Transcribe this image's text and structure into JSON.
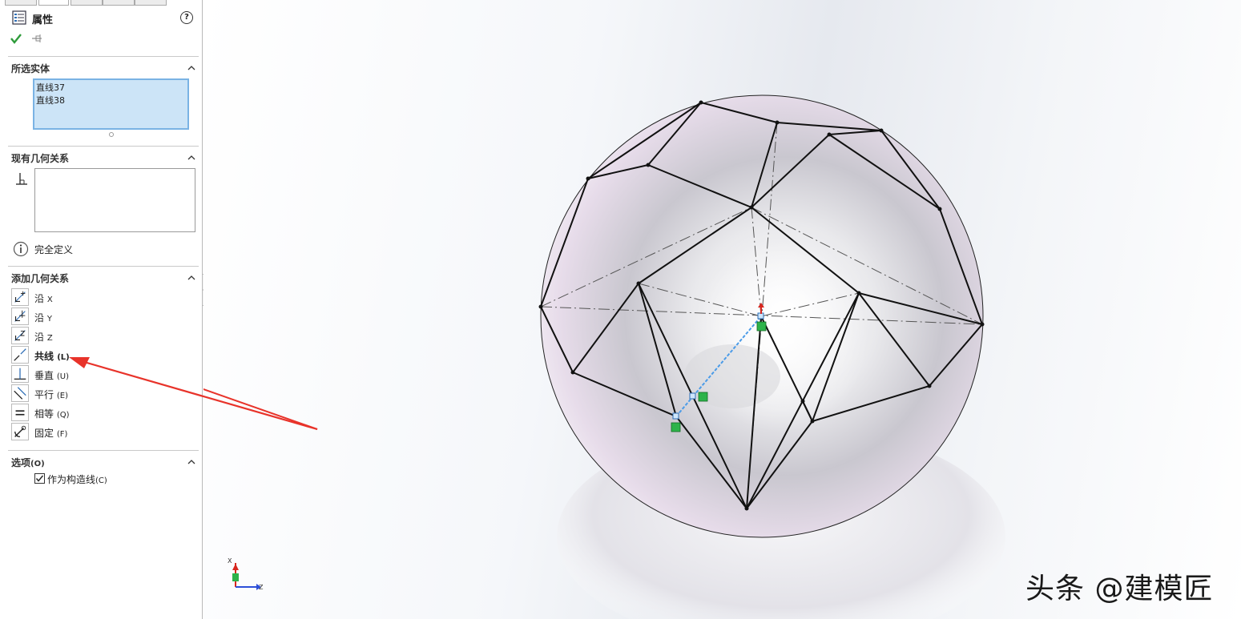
{
  "panel": {
    "title": "属性",
    "help_icon": "?",
    "sections": {
      "selected": {
        "title": "所选实体",
        "items": [
          "直线37",
          "直线38"
        ]
      },
      "existing": {
        "title": "现有几何关系",
        "status": "完全定义"
      },
      "add": {
        "title": "添加几何关系",
        "items": [
          {
            "main": "沿",
            "suffix": "X"
          },
          {
            "main": "沿",
            "suffix": "Y"
          },
          {
            "main": "沿",
            "suffix": "Z"
          },
          {
            "main": "共线",
            "suffix": "(L)"
          },
          {
            "main": "垂直",
            "suffix": "(U)"
          },
          {
            "main": "平行",
            "suffix": "(E)"
          },
          {
            "main": "相等",
            "suffix": "(Q)"
          },
          {
            "main": "固定",
            "suffix": "(F)"
          }
        ]
      },
      "options": {
        "title": "选项",
        "title_suffix": "(O)",
        "checkbox_label": "作为构造线",
        "checkbox_suffix": "(C)",
        "checkbox_checked": true
      }
    }
  },
  "viewport": {
    "triad": {
      "x_label": "X",
      "z_label": "Z"
    },
    "watermark": "头条 @建模匠"
  },
  "colors": {
    "accent_blue": "#4a9be8",
    "selection_bg": "#cce4f7",
    "arrow_red": "#e8332a",
    "marker_green": "#2db34a"
  }
}
